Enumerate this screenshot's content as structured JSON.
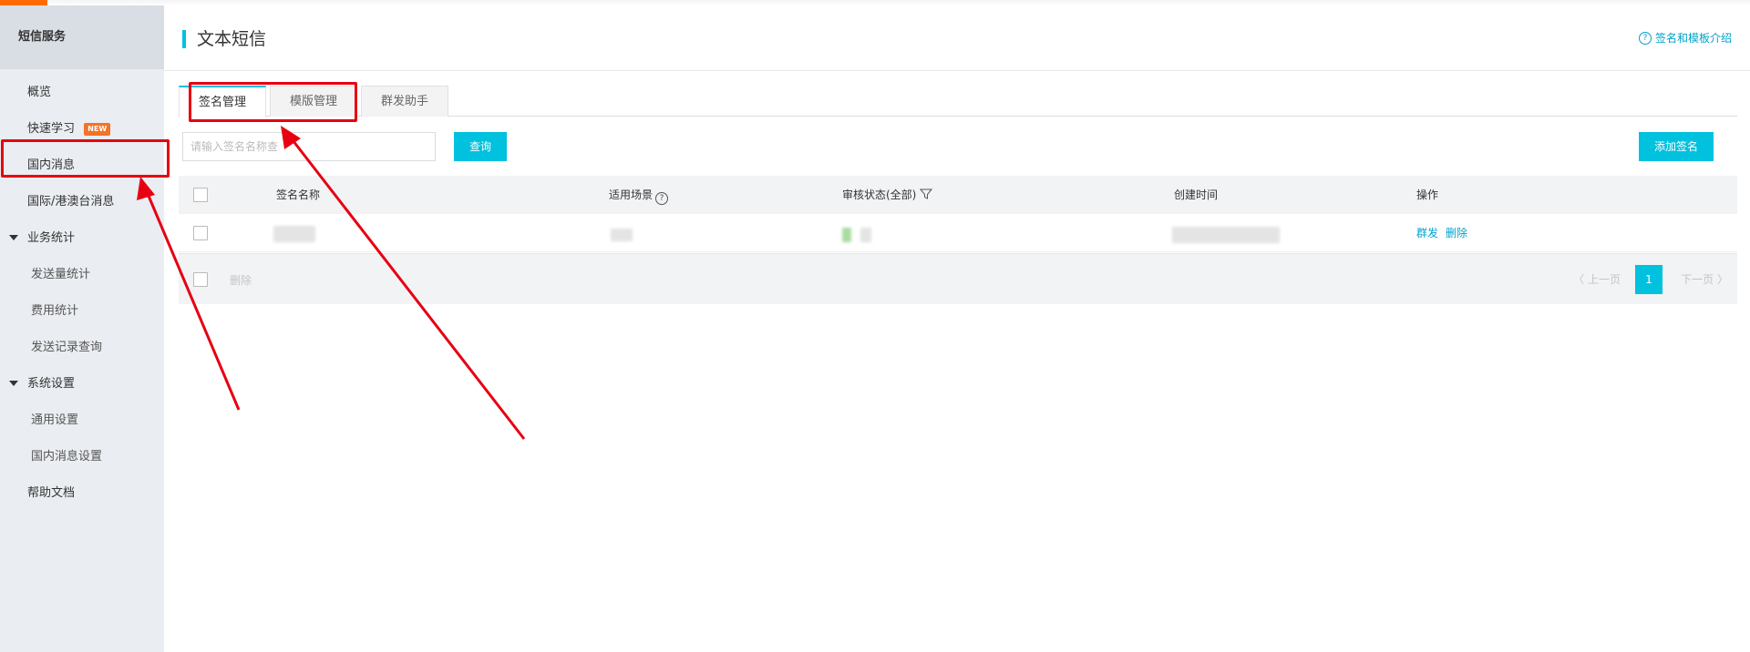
{
  "sidebar": {
    "header": "短信服务",
    "items": [
      {
        "label": "概览"
      },
      {
        "label": "快速学习",
        "badge": "NEW"
      },
      {
        "label": "国内消息"
      },
      {
        "label": "国际/港澳台消息"
      },
      {
        "label": "业务统计",
        "group": true
      },
      {
        "label": "发送量统计"
      },
      {
        "label": "费用统计"
      },
      {
        "label": "发送记录查询"
      },
      {
        "label": "系统设置",
        "group": true
      },
      {
        "label": "通用设置"
      },
      {
        "label": "国内消息设置"
      },
      {
        "label": "帮助文档"
      }
    ]
  },
  "header": {
    "title": "文本短信",
    "help_link": "签名和模板介绍"
  },
  "tabs": [
    {
      "label": "签名管理",
      "active": true
    },
    {
      "label": "模版管理"
    },
    {
      "label": "群发助手"
    }
  ],
  "search": {
    "placeholder": "请输入签名名称查",
    "button": "查询"
  },
  "add_button": "添加签名",
  "table": {
    "columns": [
      "签名名称",
      "适用场景",
      "审核状态(全部)",
      "创建时间",
      "操作"
    ],
    "actions": [
      "群发",
      "删除"
    ]
  },
  "footer": {
    "delete": "删除",
    "prev": "上一页",
    "page": "1",
    "next": "下一页"
  },
  "colors": {
    "accent": "#00c1de",
    "link": "#00a2ca",
    "highlight": "#e60012"
  }
}
